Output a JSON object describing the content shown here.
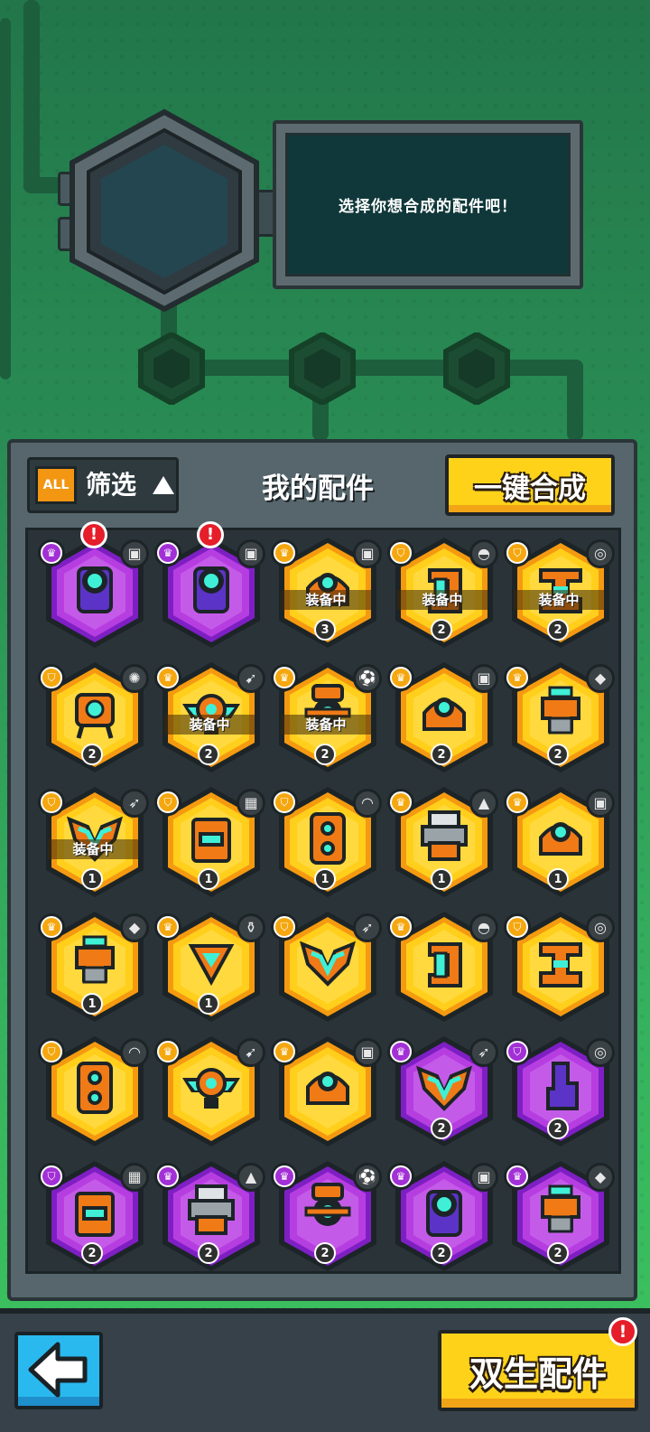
{
  "colors": {
    "gold": "#ffcf1c",
    "gold_border": "#f59a10",
    "purple": "#b63ee0",
    "purple_border": "#7e1fc4",
    "dark": "#1c2427"
  },
  "header": {
    "hint_text": "选择你想合成的配件吧！"
  },
  "toolbar": {
    "filter_badge": "ALL",
    "filter_label": "筛选",
    "title": "我的配件",
    "merge_all_label": "一键合成"
  },
  "items": [
    {
      "rarity": "purple",
      "rank_icon": "crown-icon",
      "element_icon": "cassette-icon",
      "glyph": "camera",
      "equipped": "",
      "level": "",
      "alert": "!"
    },
    {
      "rarity": "purple",
      "rank_icon": "crown-icon",
      "element_icon": "cassette-icon",
      "glyph": "camera",
      "equipped": "",
      "level": "",
      "alert": "!"
    },
    {
      "rarity": "gold",
      "rank_icon": "crown-icon",
      "element_icon": "cassette-icon",
      "glyph": "dome",
      "equipped": "装备中",
      "level": "3",
      "alert": ""
    },
    {
      "rarity": "gold",
      "rank_icon": "shield-icon",
      "element_icon": "watermelon-icon",
      "glyph": "bracket",
      "equipped": "装备中",
      "level": "2",
      "alert": ""
    },
    {
      "rarity": "gold",
      "rank_icon": "shield-icon",
      "element_icon": "target-icon",
      "glyph": "hbrace",
      "equipped": "装备中",
      "level": "2",
      "alert": ""
    },
    {
      "rarity": "gold",
      "rank_icon": "shield-icon",
      "element_icon": "virus-icon",
      "glyph": "walker",
      "equipped": "",
      "level": "2",
      "alert": ""
    },
    {
      "rarity": "gold",
      "rank_icon": "crown-icon",
      "element_icon": "drill-icon",
      "glyph": "wings",
      "equipped": "装备中",
      "level": "2",
      "alert": ""
    },
    {
      "rarity": "gold",
      "rank_icon": "crown-icon",
      "element_icon": "soccer-icon",
      "glyph": "tripod",
      "equipped": "装备中",
      "level": "2",
      "alert": ""
    },
    {
      "rarity": "gold",
      "rank_icon": "crown-icon",
      "element_icon": "cassette-icon",
      "glyph": "dome",
      "equipped": "",
      "level": "2",
      "alert": ""
    },
    {
      "rarity": "gold",
      "rank_icon": "crown-icon",
      "element_icon": "shield-red-icon",
      "glyph": "pylon",
      "equipped": "",
      "level": "2",
      "alert": ""
    },
    {
      "rarity": "gold",
      "rank_icon": "shield-icon",
      "element_icon": "rocket-icon",
      "glyph": "chevron",
      "equipped": "装备中",
      "level": "1",
      "alert": ""
    },
    {
      "rarity": "gold",
      "rank_icon": "shield-icon",
      "element_icon": "brick-icon",
      "glyph": "screen",
      "equipped": "",
      "level": "1",
      "alert": ""
    },
    {
      "rarity": "gold",
      "rank_icon": "shield-icon",
      "element_icon": "boomerang-icon",
      "glyph": "twin",
      "equipped": "",
      "level": "1",
      "alert": ""
    },
    {
      "rarity": "gold",
      "rank_icon": "crown-icon",
      "element_icon": "cone-icon",
      "glyph": "printer",
      "equipped": "",
      "level": "1",
      "alert": ""
    },
    {
      "rarity": "gold",
      "rank_icon": "crown-icon",
      "element_icon": "cassette-icon",
      "glyph": "dome",
      "equipped": "",
      "level": "1",
      "alert": ""
    },
    {
      "rarity": "gold",
      "rank_icon": "crown-icon",
      "element_icon": "shield-red-icon",
      "glyph": "pylon",
      "equipped": "",
      "level": "1",
      "alert": ""
    },
    {
      "rarity": "gold",
      "rank_icon": "crown-icon",
      "element_icon": "bottle-icon",
      "glyph": "triangle",
      "equipped": "",
      "level": "1",
      "alert": ""
    },
    {
      "rarity": "gold",
      "rank_icon": "shield-icon",
      "element_icon": "rocket-icon",
      "glyph": "chevron",
      "equipped": "",
      "level": "",
      "alert": ""
    },
    {
      "rarity": "gold",
      "rank_icon": "crown-icon",
      "element_icon": "watermelon-icon",
      "glyph": "bracket",
      "equipped": "",
      "level": "",
      "alert": ""
    },
    {
      "rarity": "gold",
      "rank_icon": "shield-icon",
      "element_icon": "target-icon",
      "glyph": "hbrace",
      "equipped": "",
      "level": "",
      "alert": ""
    },
    {
      "rarity": "gold",
      "rank_icon": "shield-icon",
      "element_icon": "boomerang-icon",
      "glyph": "twin",
      "equipped": "",
      "level": "",
      "alert": ""
    },
    {
      "rarity": "gold",
      "rank_icon": "crown-icon",
      "element_icon": "drill-icon",
      "glyph": "wings",
      "equipped": "",
      "level": "",
      "alert": ""
    },
    {
      "rarity": "gold",
      "rank_icon": "crown-icon",
      "element_icon": "cassette-icon",
      "glyph": "dome",
      "equipped": "",
      "level": "",
      "alert": ""
    },
    {
      "rarity": "purple",
      "rank_icon": "crown-icon",
      "element_icon": "rocket-icon",
      "glyph": "chevron",
      "equipped": "",
      "level": "2",
      "alert": ""
    },
    {
      "rarity": "purple",
      "rank_icon": "shield-icon",
      "element_icon": "target-icon",
      "glyph": "pillar",
      "equipped": "",
      "level": "2",
      "alert": ""
    },
    {
      "rarity": "purple",
      "rank_icon": "shield-icon",
      "element_icon": "brick-icon",
      "glyph": "screen",
      "equipped": "",
      "level": "2",
      "alert": ""
    },
    {
      "rarity": "purple",
      "rank_icon": "crown-icon",
      "element_icon": "cone-icon",
      "glyph": "printer",
      "equipped": "",
      "level": "2",
      "alert": ""
    },
    {
      "rarity": "purple",
      "rank_icon": "crown-icon",
      "element_icon": "soccer-icon",
      "glyph": "tripod",
      "equipped": "",
      "level": "2",
      "alert": ""
    },
    {
      "rarity": "purple",
      "rank_icon": "crown-icon",
      "element_icon": "cassette-icon",
      "glyph": "camera",
      "equipped": "",
      "level": "2",
      "alert": ""
    },
    {
      "rarity": "purple",
      "rank_icon": "crown-icon",
      "element_icon": "shield-red-icon",
      "glyph": "pylon",
      "equipped": "",
      "level": "2",
      "alert": ""
    }
  ],
  "footer": {
    "back_icon": "arrow-left-icon",
    "twin_label": "双生配件",
    "twin_alert": "!"
  }
}
